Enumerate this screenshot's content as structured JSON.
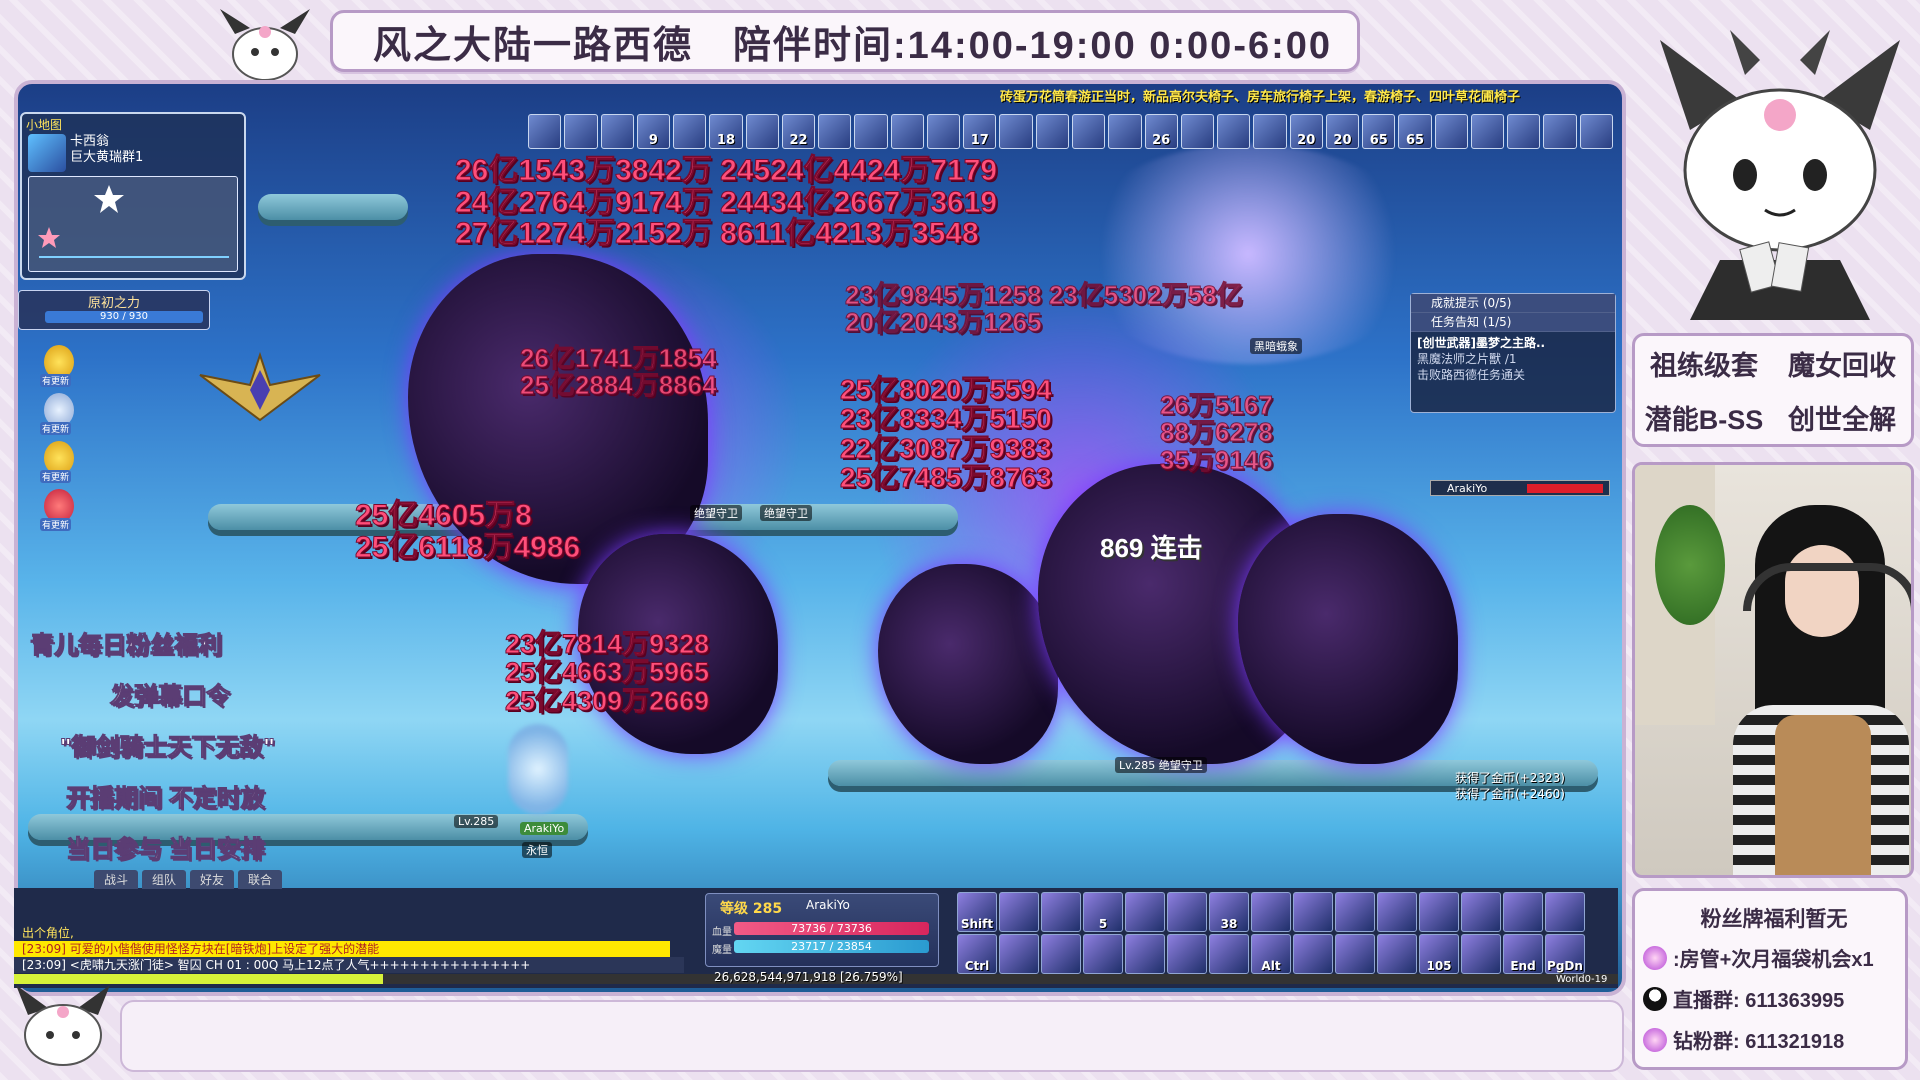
{
  "banner": {
    "title": "风之大陆一路西德",
    "schedule": "陪伴时间:14:00-19:00  0:00-6:00"
  },
  "game": {
    "ticker": "砖蛋万花筒春游正当时，新品高尔夫椅子、房车旅行椅子上架，春游椅子、四叶草花圃椅子",
    "buffs": [
      "",
      "",
      "",
      "9",
      "",
      "18",
      "",
      "22",
      "",
      "",
      "",
      "",
      "17",
      "",
      "",
      "",
      "",
      "26",
      "",
      "",
      "",
      "20",
      "20",
      "65",
      "65",
      "",
      "",
      "",
      "",
      ""
    ],
    "minimap": {
      "title": "小地图",
      "map_name_1": "卡西翁",
      "map_name_2": "巨大黄瑞群1"
    },
    "power": {
      "title": "原初之力",
      "value": "930 / 930"
    },
    "left_notes": [
      "有更新",
      "有更新",
      "有更新",
      "有更新"
    ],
    "damage_top": [
      "26亿1543万3842万 24524亿4424万7179",
      "24亿2764万9174万 24434亿2667万3619",
      "27亿1274万2152万 8611亿4213万3548"
    ],
    "damage_mid": [
      "25亿8020万5594",
      "23亿8334万5150",
      "22亿3087万9383",
      "25亿7485万8763"
    ],
    "damage_mid2": [
      "26亿1741万1854",
      "25亿2884万8864"
    ],
    "damage_right": [
      "26万5167",
      "88万6278",
      "35万9146"
    ],
    "damage_left": [
      "25亿4605万8",
      "25亿6118万4986"
    ],
    "damage_low": [
      "23亿7814万9328",
      "25亿4663万5965",
      "25亿4309万2669"
    ],
    "damage_upper_mid": [
      "23亿9845万1258 23亿5302万58亿",
      "20亿2043万1265"
    ],
    "labels": {
      "guard1": "绝望守卫",
      "guard2": "绝望守卫",
      "guard3": "Lv.285 绝望守卫",
      "dark": "黑暗蛾象",
      "combo": "869 连击",
      "player_lv": "Lv.285",
      "player_name": "ArakiYo",
      "guild": "永恒"
    },
    "fan_overlay": [
      "青儿每日粉丝福利",
      "发弹幕口令",
      "\"御剑骑士天下无敌\"",
      "开播期间   不定时放",
      "当日参与   当日安排"
    ],
    "quest": {
      "achievement": "成就提示 (0/5)",
      "task": "任务告知 (1/5)",
      "quest_title": "[创世武器]墨梦之主路..",
      "quest_line1": "黑魔法师之片獸    /1",
      "quest_line2": "击败路西德任务通关"
    },
    "target": {
      "name": "ArakiYo"
    },
    "gold": [
      "获得了金币(+2323)",
      "获得了金币(+2460)"
    ],
    "chat": {
      "tabs": [
        "战斗",
        "组队",
        "好友",
        "联合"
      ],
      "line1": "出个角位,",
      "line2": "[23:09] 可爱的小偕偕使用怪怪方块在[暗铁炮]上设定了强大的潜能",
      "line3": "[23:09] <虎啸九天涨门徒> 智囚 CH 01 : 00Q 马上12点了人气++++++++++++++++"
    },
    "status": {
      "level": "等级 285",
      "name": "ArakiYo",
      "hp_label": "血量",
      "mp_label": "魔量",
      "hp": "73736 / 73736",
      "mp": "23717 / 23854"
    },
    "exp": "26,628,544,971,918 [26.759%]",
    "world": "World0-19",
    "skills": [
      "Shift",
      "",
      "",
      "5",
      "",
      "",
      "38",
      "",
      "",
      "",
      "",
      "",
      "",
      "",
      "",
      "Ctrl",
      "",
      "",
      "",
      "",
      "",
      "",
      "Alt",
      "",
      "",
      "",
      "105",
      "",
      "End",
      "PgDn"
    ]
  },
  "promo": [
    "祖练级套",
    "魔女回收",
    "潜能B-SS",
    "创世全解"
  ],
  "fans": {
    "header": "粉丝牌福利暂无",
    "row1": ":房管+次月福袋机会x1",
    "row2": "直播群: 611363995",
    "row3": "钻粉群: 611321918"
  },
  "colors": {
    "frame": "#ece1f0",
    "border": "#b79ac6",
    "damage": "#ff4f7a",
    "text_dark": "#3b2c46"
  }
}
